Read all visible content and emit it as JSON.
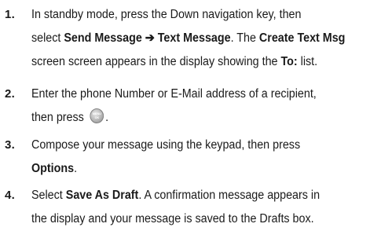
{
  "steps": [
    {
      "number": "1.",
      "line1": "In standby mode, press the Down navigation key, then",
      "line2_pre": "select ",
      "line2_bold": "Send Message ➔ Text Message",
      "line2_mid": ". The ",
      "line2_bold2": "Create Text Msg",
      "line3": "screen screen appears in the display showing the ",
      "line3_bold": "To:",
      "line3_post": " list."
    },
    {
      "number": "2.",
      "line1": "Enter the phone Number or E-Mail address of a recipient,",
      "line2_pre": "then press ",
      "line2_post": ".",
      "key_icon_top": "MENU",
      "key_icon_bottom": "OK"
    },
    {
      "number": "3.",
      "line1": "Compose your message using the keypad, then press",
      "line2_bold": "Options",
      "line2_post": "."
    },
    {
      "number": "4.",
      "line1_pre": "Select ",
      "line1_bold": "Save As Draft",
      "line1_post": ". A confirmation message appears in",
      "line2": "the display and your message is saved to the Drafts box."
    }
  ]
}
